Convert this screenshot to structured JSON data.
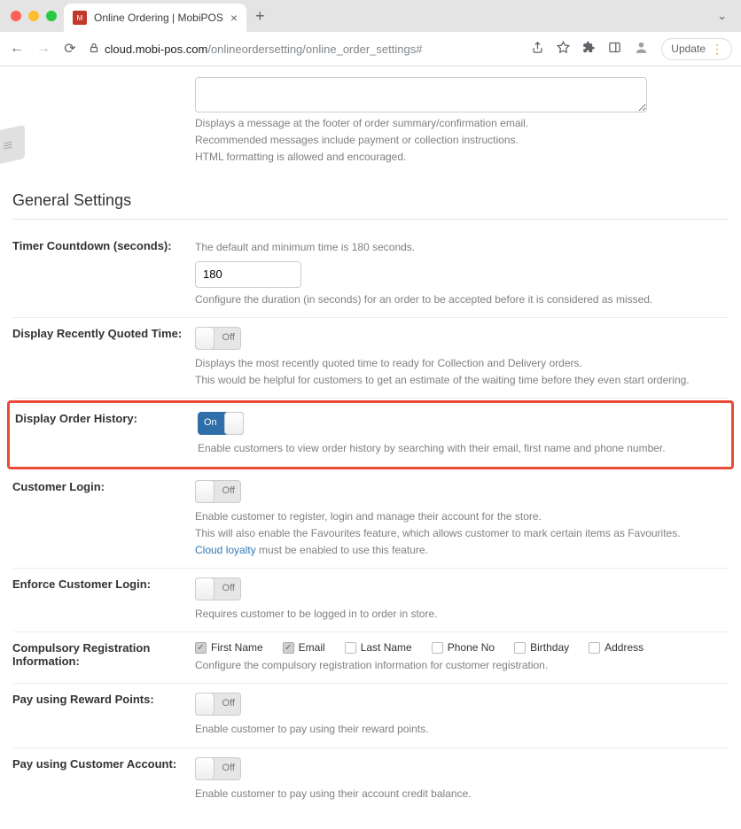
{
  "browser": {
    "tab_title": "Online Ordering | MobiPOS",
    "url_host": "cloud.mobi-pos.com",
    "url_path": "/onlineordersetting/online_order_settings#",
    "update_label": "Update"
  },
  "footer_msg": {
    "help1": "Displays a message at the footer of order summary/confirmation email.",
    "help2": "Recommended messages include payment or collection instructions.",
    "help3": "HTML formatting is allowed and encouraged."
  },
  "section_title": "General Settings",
  "timer": {
    "label": "Timer Countdown (seconds):",
    "help_top": "The default and minimum time is 180 seconds.",
    "value": "180",
    "help_bottom": "Configure the duration (in seconds) for an order to be accepted before it is considered as missed."
  },
  "recent_quoted": {
    "label": "Display Recently Quoted Time:",
    "toggle": "Off",
    "help1": "Displays the most recently quoted time to ready for Collection and Delivery orders.",
    "help2": "This would be helpful for customers to get an estimate of the waiting time before they even start ordering."
  },
  "order_history": {
    "label": "Display Order History:",
    "toggle": "On",
    "help": "Enable customers to view order history by searching with their email, first name and phone number."
  },
  "customer_login": {
    "label": "Customer Login:",
    "toggle": "Off",
    "help1": "Enable customer to register, login and manage their account for the store.",
    "help2": "This will also enable the Favourites feature, which allows customer to mark certain items as Favourites.",
    "link": "Cloud loyalty",
    "help3": " must be enabled to use this feature."
  },
  "enforce_login": {
    "label": "Enforce Customer Login:",
    "toggle": "Off",
    "help": "Requires customer to be logged in to order in store."
  },
  "compulsory": {
    "label": "Compulsory Registration Information:",
    "options": {
      "first_name": "First Name",
      "email": "Email",
      "last_name": "Last Name",
      "phone_no": "Phone No",
      "birthday": "Birthday",
      "address": "Address"
    },
    "help": "Configure the compulsory registration information for customer registration."
  },
  "reward_points": {
    "label": "Pay using Reward Points:",
    "toggle": "Off",
    "help": "Enable customer to pay using their reward points."
  },
  "customer_account": {
    "label": "Pay using Customer Account:",
    "toggle": "Off",
    "help": "Enable customer to pay using their account credit balance."
  }
}
